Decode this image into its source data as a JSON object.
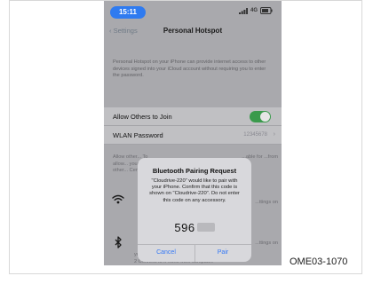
{
  "status_bar": {
    "time": "15:11",
    "network": "4G",
    "accent_color": "#2f7bf0"
  },
  "nav": {
    "back_label": "Settings",
    "title": "Personal Hotspot"
  },
  "description": "Personal Hotspot on your iPhone can provide internet access to other devices signed into your iCloud account without requiring you to enter the password.",
  "settings": {
    "allow_label": "Allow Others to Join",
    "allow_enabled": true,
    "wlan_label": "WLAN Password",
    "wlan_value": "12345678"
  },
  "background_text": {
    "left_fragment": "Allow other... To allow... your other... Center.",
    "right_fragment": "...able for ...from",
    "right_fragment_2": "...ttings on",
    "right_fragment_3": "...ttings on",
    "bottom_line_1": "your computer.",
    "bottom_line_2": "2 Connect to iPhone from computer."
  },
  "icons": {
    "wifi": "wifi-icon",
    "bluetooth": "bluetooth-icon",
    "back": "chevron-left-icon",
    "chevron": "chevron-right-icon"
  },
  "alert": {
    "title": "Bluetooth Pairing Request",
    "message": "\"Cloudrive-220\" would like to pair with your iPhone. Confirm that this code is shown on \"Cloudrive-220\". Do not enter this code on any accessory.",
    "code": "596",
    "cancel_label": "Cancel",
    "pair_label": "Pair",
    "button_color": "#3478f6"
  },
  "figure_code": "OME03-1070"
}
